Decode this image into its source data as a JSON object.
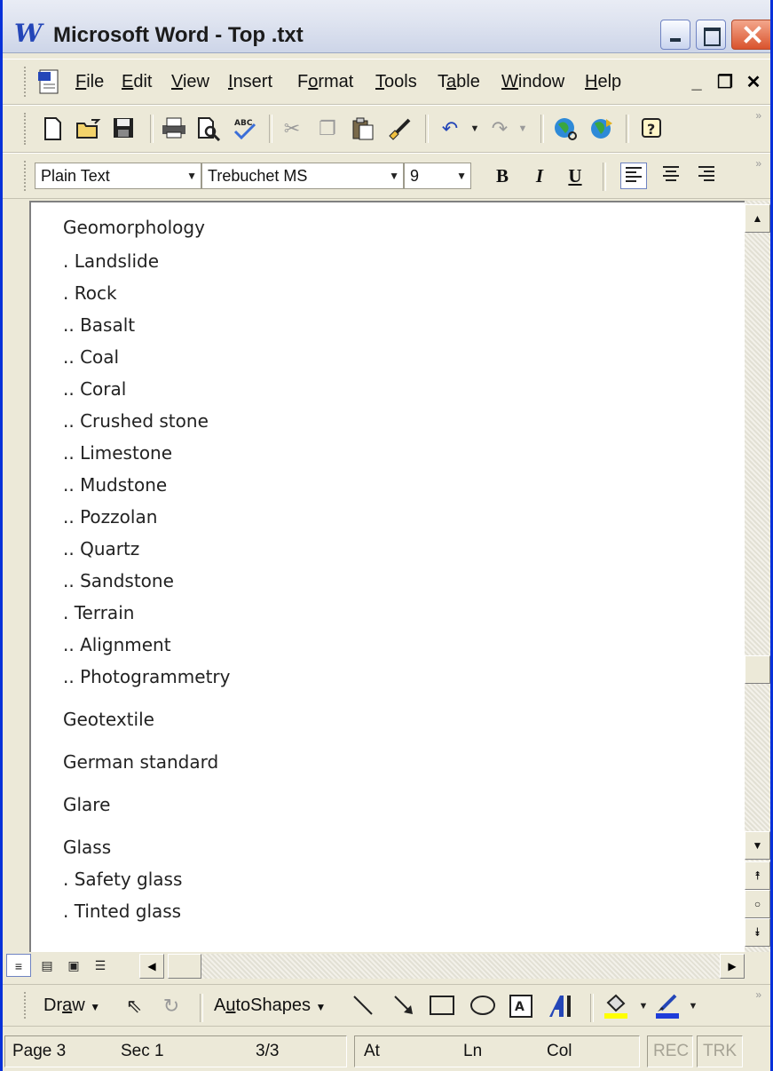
{
  "window": {
    "title": "Microsoft Word - Top .txt",
    "logo_glyph": "W"
  },
  "menu": {
    "items": [
      {
        "underline": "F",
        "rest": "ile"
      },
      {
        "underline": "E",
        "rest": "dit"
      },
      {
        "underline": "V",
        "rest": "iew"
      },
      {
        "underline": "I",
        "rest": "nsert"
      },
      {
        "before": "F",
        "underline": "o",
        "rest": "rmat"
      },
      {
        "underline": "T",
        "rest": "ools"
      },
      {
        "before": "T",
        "underline": "a",
        "rest": "ble"
      },
      {
        "underline": "W",
        "rest": "indow"
      },
      {
        "underline": "H",
        "rest": "elp"
      }
    ]
  },
  "formatting": {
    "style": "Plain Text",
    "font": "Trebuchet MS",
    "size": "9",
    "bold": "B",
    "italic": "I",
    "underline": "U"
  },
  "document": {
    "lines": [
      "Geomorphology",
      ". Landslide",
      ". Rock",
      ".. Basalt",
      ".. Coal",
      ".. Coral",
      ".. Crushed stone",
      ".. Limestone",
      ".. Mudstone",
      ".. Pozzolan",
      ".. Quartz",
      ".. Sandstone",
      ". Terrain",
      ".. Alignment",
      ".. Photogrammetry",
      "Geotextile",
      "German standard",
      "Glare",
      "Glass",
      ". Safety glass",
      ". Tinted glass"
    ]
  },
  "drawing": {
    "draw_before": "Dr",
    "draw_u": "a",
    "draw_after": "w",
    "autoshapes_before": "A",
    "autoshapes_u": "u",
    "autoshapes_after": "toShapes"
  },
  "status": {
    "page": "Page 3",
    "sec": "Sec 1",
    "pages": "3/3",
    "at": "At",
    "ln": "Ln",
    "col": "Col",
    "rec": "REC",
    "trk": "TRK"
  }
}
